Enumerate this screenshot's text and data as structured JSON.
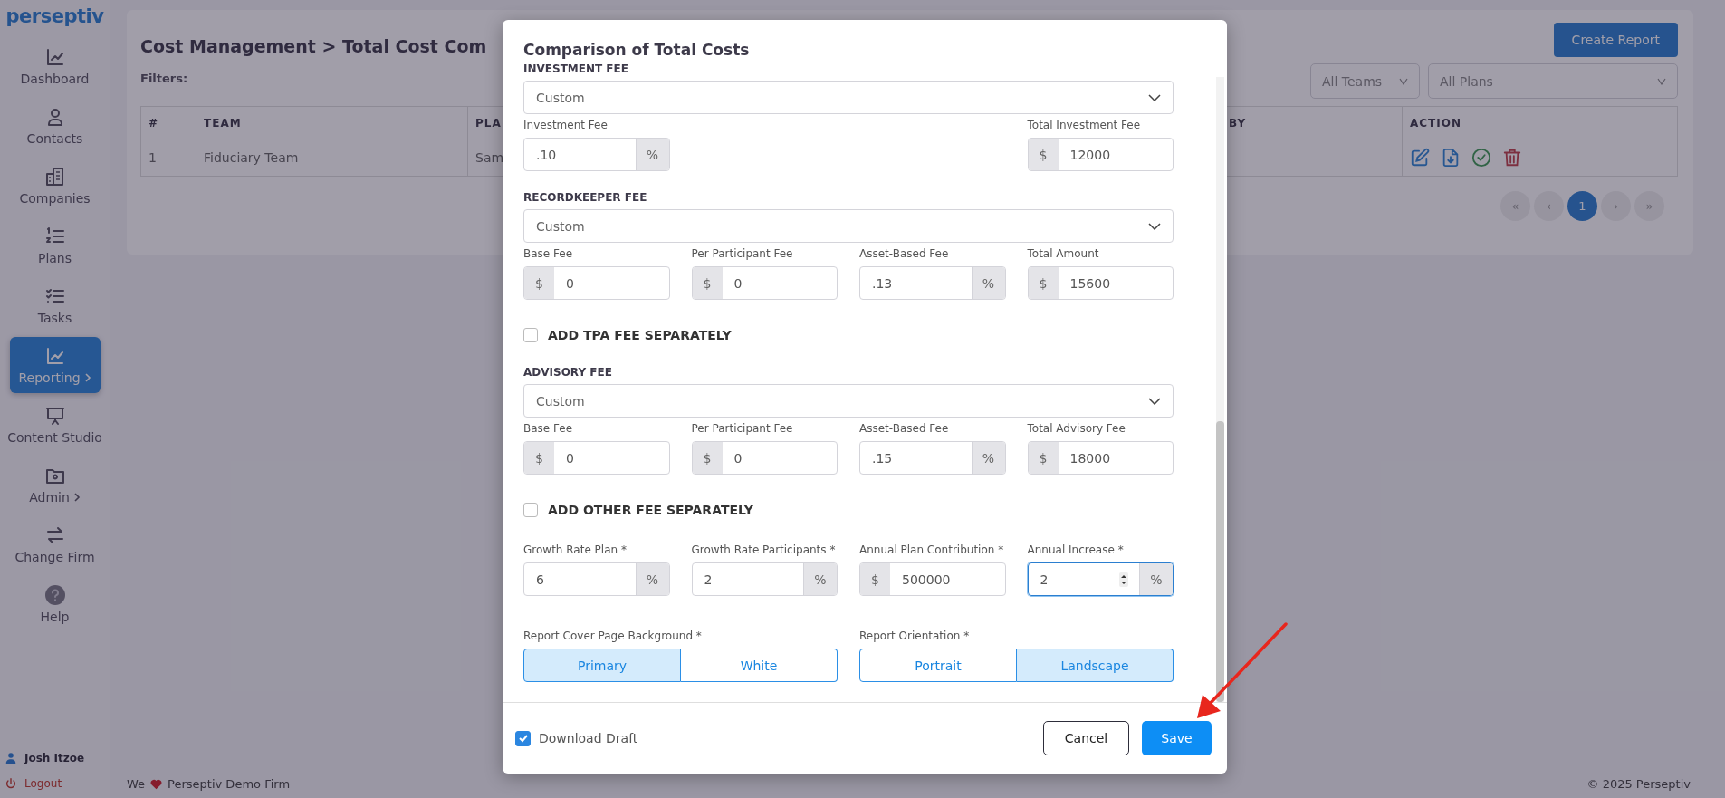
{
  "sidebar": {
    "logo": "perseptiv",
    "items": [
      {
        "label": "Dashboard",
        "selected": false,
        "has_submenu": false
      },
      {
        "label": "Contacts",
        "selected": false,
        "has_submenu": false
      },
      {
        "label": "Companies",
        "selected": false,
        "has_submenu": false
      },
      {
        "label": "Plans",
        "selected": false,
        "has_submenu": false
      },
      {
        "label": "Tasks",
        "selected": false,
        "has_submenu": false
      },
      {
        "label": "Reporting",
        "selected": true,
        "has_submenu": true
      },
      {
        "label": "Content Studio",
        "selected": false,
        "has_submenu": false
      },
      {
        "label": "Admin",
        "selected": false,
        "has_submenu": true
      },
      {
        "label": "Change Firm",
        "selected": false,
        "has_submenu": false
      },
      {
        "label": "Help",
        "selected": false,
        "has_submenu": false
      }
    ],
    "user": "Josh Itzoe",
    "logout": "Logout"
  },
  "page": {
    "title": "Cost Management > Total Cost Com",
    "create_button": "Create Report",
    "filters_label": "Filters:",
    "filters": [
      "All Teams",
      "All Plans"
    ],
    "table": {
      "columns": [
        "#",
        "TEAM",
        "PLA",
        "BY",
        "ACTION"
      ],
      "rows": [
        {
          "cells": [
            "1",
            "Fiduciary Team",
            "Sam"
          ]
        }
      ]
    },
    "pagination": [
      {
        "label": "«",
        "selected": false
      },
      {
        "label": "‹",
        "selected": false
      },
      {
        "label": "1",
        "selected": true
      },
      {
        "label": "›",
        "selected": false
      },
      {
        "label": "»",
        "selected": false
      }
    ]
  },
  "footer": {
    "left_before": "We",
    "left_after": "Perseptiv Demo Firm",
    "right": "© 2025 Perseptiv"
  },
  "modal": {
    "title": "Comparison of Total Costs",
    "sections": [
      {
        "kind": "fee",
        "title": "INVESTMENT FEE",
        "select": "Custom",
        "fields": [
          {
            "label": "Investment Fee",
            "value": ".10",
            "suffix": "%"
          },
          {
            "label": "Total Investment Fee",
            "value": "12000",
            "prefix": "$"
          }
        ]
      },
      {
        "kind": "fee",
        "title": "RECORDKEEPER FEE",
        "select": "Custom",
        "fields": [
          {
            "label": "Base Fee",
            "value": "0",
            "prefix": "$"
          },
          {
            "label": "Per Participant Fee",
            "value": "0",
            "prefix": "$"
          },
          {
            "label": "Asset-Based Fee",
            "value": ".13",
            "suffix": "%"
          },
          {
            "label": "Total Amount",
            "value": "15600",
            "prefix": "$"
          }
        ]
      },
      {
        "kind": "checkbox",
        "label": "ADD TPA FEE SEPARATELY",
        "checked": false
      },
      {
        "kind": "fee",
        "title": "ADVISORY FEE",
        "select": "Custom",
        "fields": [
          {
            "label": "Base Fee",
            "value": "0",
            "prefix": "$"
          },
          {
            "label": "Per Participant Fee",
            "value": "0",
            "prefix": "$"
          },
          {
            "label": "Asset-Based Fee",
            "value": ".15",
            "suffix": "%"
          },
          {
            "label": "Total Advisory Fee",
            "value": "18000",
            "prefix": "$"
          }
        ]
      },
      {
        "kind": "checkbox",
        "label": "ADD OTHER FEE SEPARATELY",
        "checked": false
      },
      {
        "kind": "fields",
        "fields": [
          {
            "label": "Growth Rate Plan *",
            "value": "6",
            "suffix": "%",
            "focused": false
          },
          {
            "label": "Growth Rate Participants *",
            "value": "2",
            "suffix": "%",
            "focused": false
          },
          {
            "label": "Annual Plan Contribution *",
            "value": "500000",
            "prefix": "$",
            "focused": false
          },
          {
            "label": "Annual Increase *",
            "value": "2",
            "suffix": "%",
            "focused": true
          }
        ]
      },
      {
        "kind": "toggles",
        "groups": [
          {
            "label": "Report Cover Page Background *",
            "options": [
              {
                "label": "Primary",
                "selected": true
              },
              {
                "label": "White",
                "selected": false
              }
            ]
          },
          {
            "label": "Report Orientation *",
            "options": [
              {
                "label": "Portrait",
                "selected": false
              },
              {
                "label": "Landscape",
                "selected": true
              }
            ]
          }
        ]
      }
    ],
    "download_draft": {
      "label": "Download Draft",
      "checked": true
    },
    "buttons": [
      {
        "label": "Cancel",
        "kind": "secondary"
      },
      {
        "label": "Save",
        "kind": "primary"
      }
    ]
  }
}
